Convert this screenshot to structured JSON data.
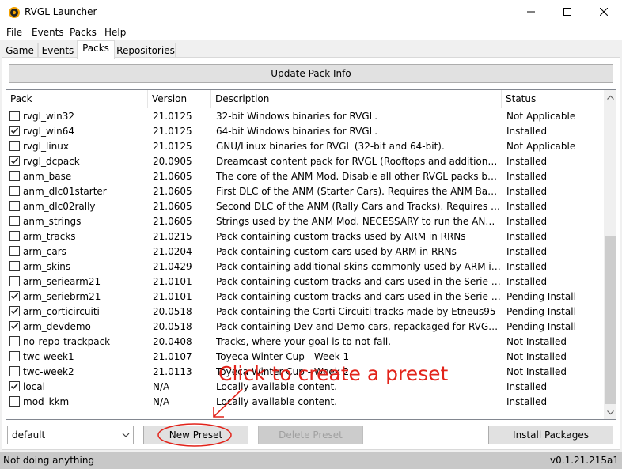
{
  "window": {
    "title": "RVGL Launcher"
  },
  "menu": [
    "File",
    "Events",
    "Packs",
    "Help"
  ],
  "tabs": [
    "Game",
    "Events",
    "Packs",
    "Repositories"
  ],
  "active_tab": "Packs",
  "update_button": "Update Pack Info",
  "list": {
    "columns": [
      "Pack",
      "Version",
      "Description",
      "Status"
    ],
    "rows": [
      {
        "checked": false,
        "pack": "rvgl_win32",
        "version": "21.0125",
        "description": "32-bit Windows binaries for RVGL.",
        "status": "Not Applicable"
      },
      {
        "checked": true,
        "pack": "rvgl_win64",
        "version": "21.0125",
        "description": "64-bit Windows binaries for RVGL.",
        "status": "Installed"
      },
      {
        "checked": false,
        "pack": "rvgl_linux",
        "version": "21.0125",
        "description": "GNU/Linux binaries for RVGL (32-bit and 64-bit).",
        "status": "Not Applicable"
      },
      {
        "checked": true,
        "pack": "rvgl_dcpack",
        "version": "20.0905",
        "description": "Dreamcast content pack for RVGL (Rooftops and additional cars).",
        "status": "Installed"
      },
      {
        "checked": false,
        "pack": "anm_base",
        "version": "21.0605",
        "description": "The core of the ANM Mod. Disable all other RVGL packs before us...",
        "status": "Installed"
      },
      {
        "checked": false,
        "pack": "anm_dlc01starter",
        "version": "21.0605",
        "description": "First DLC of the ANM (Starter Cars). Requires the ANM Base Pack ...",
        "status": "Installed"
      },
      {
        "checked": false,
        "pack": "anm_dlc02rally",
        "version": "21.0605",
        "description": "Second DLC of the ANM (Rally Cars and Tracks). Requires the AN...",
        "status": "Installed"
      },
      {
        "checked": false,
        "pack": "anm_strings",
        "version": "21.0605",
        "description": "Strings used by the ANM Mod. NECESSARY to run the ANM corre...",
        "status": "Installed"
      },
      {
        "checked": false,
        "pack": "arm_tracks",
        "version": "21.0215",
        "description": "Pack containing custom tracks used by ARM in RRNs",
        "status": "Installed"
      },
      {
        "checked": false,
        "pack": "arm_cars",
        "version": "21.0204",
        "description": "Pack containing custom cars used by ARM in RRNs",
        "status": "Installed"
      },
      {
        "checked": false,
        "pack": "arm_skins",
        "version": "21.0429",
        "description": "Pack containing additional skins commonly used by ARM in RRNs",
        "status": "Installed"
      },
      {
        "checked": false,
        "pack": "arm_seriearm21",
        "version": "21.0101",
        "description": "Pack containing custom tracks and cars used in the Serie Arm tou...",
        "status": "Installed"
      },
      {
        "checked": true,
        "pack": "arm_seriebrm21",
        "version": "21.0101",
        "description": "Pack containing custom tracks and cars used in the Serie Brm tou...",
        "status": "Pending Install"
      },
      {
        "checked": true,
        "pack": "arm_corticircuiti",
        "version": "20.0518",
        "description": "Pack containing the Corti Circuiti tracks made by Etneus95",
        "status": "Pending Install"
      },
      {
        "checked": true,
        "pack": "arm_devdemo",
        "version": "20.0518",
        "description": "Pack containing Dev and Demo cars, repackaged for RVGL by Etn...",
        "status": "Pending Install"
      },
      {
        "checked": false,
        "pack": "no-repo-trackpack",
        "version": "20.0408",
        "description": "Tracks, where your goal is to not fall.",
        "status": "Not Installed"
      },
      {
        "checked": false,
        "pack": "twc-week1",
        "version": "21.0107",
        "description": "Toyeca Winter Cup - Week 1",
        "status": "Not Installed"
      },
      {
        "checked": false,
        "pack": "twc-week2",
        "version": "21.0113",
        "description": "Toyeca Winter Cup - Week 2",
        "status": "Not Installed"
      },
      {
        "checked": true,
        "pack": "local",
        "version": "N/A",
        "description": "Locally available content.",
        "status": "Installed"
      },
      {
        "checked": false,
        "pack": "mod_kkm",
        "version": "N/A",
        "description": "Locally available content.",
        "status": "Installed"
      }
    ]
  },
  "preset": {
    "selected": "default"
  },
  "buttons": {
    "new_preset": "New Preset",
    "delete_preset": "Delete Preset",
    "install_packages": "Install Packages"
  },
  "annotation": {
    "text": "Click to create a preset",
    "color": "#e2231a"
  },
  "status": {
    "left": "Not doing anything",
    "right": "v0.1.21.215a1"
  }
}
